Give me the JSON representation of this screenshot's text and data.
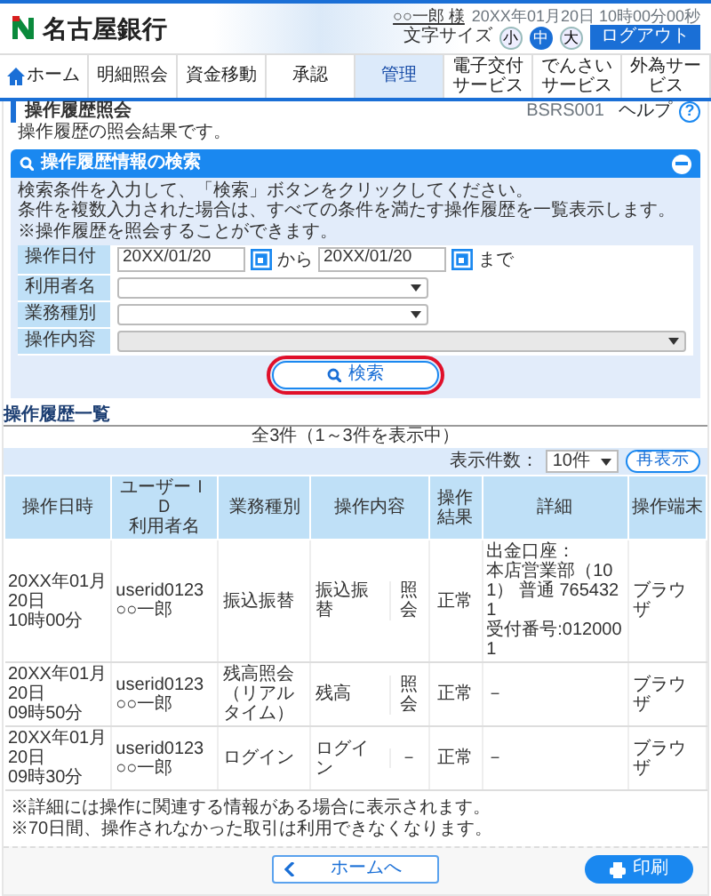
{
  "header": {
    "bank_name": "名古屋銀行",
    "user_name": "○○一郎 様",
    "datetime": "20XX年01月20日 10時00分00秒",
    "font_size_label": "文字サイズ",
    "font_sizes": [
      {
        "label": "小",
        "selected": false
      },
      {
        "label": "中",
        "selected": true
      },
      {
        "label": "大",
        "selected": false
      }
    ],
    "logout": "ログアウト"
  },
  "nav": [
    {
      "label": "ホーム",
      "kind": "home",
      "selected": false
    },
    {
      "label": "明細照会",
      "kind": "plain",
      "selected": false
    },
    {
      "label": "資金移動",
      "kind": "plain",
      "selected": false
    },
    {
      "label": "承認",
      "kind": "plain",
      "selected": false
    },
    {
      "label": "管理",
      "kind": "plain",
      "selected": true
    },
    {
      "label": "電子交付サービス",
      "kind": "plain",
      "selected": false
    },
    {
      "label": "でんさいサービス",
      "kind": "plain",
      "selected": false
    },
    {
      "label": "外為サービス",
      "kind": "plain",
      "selected": false
    }
  ],
  "page": {
    "title": "操作履歴照会",
    "code": "BSRS001",
    "help": "ヘルプ",
    "help_mark": "?"
  },
  "intro": "操作履歴の照会結果です。",
  "search": {
    "title": "操作履歴情報の検索",
    "expanded": true,
    "instructions": [
      "検索条件を入力して、「検索」ボタンをクリックしてください。",
      "条件を複数入力された場合は、すべての条件を満たす操作履歴を一覧表示します。",
      "※操作履歴を照会することができます。"
    ],
    "fields": [
      {
        "label": "操作日付",
        "kind": "date_range",
        "from": "20XX/01/20",
        "between": "から",
        "to": "20XX/01/20",
        "after": "まで"
      },
      {
        "label": "利用者名",
        "kind": "select",
        "disabled": false
      },
      {
        "label": "業務種別",
        "kind": "select",
        "disabled": false
      },
      {
        "label": "操作内容",
        "kind": "select",
        "disabled": true
      }
    ],
    "button": "検索"
  },
  "results": {
    "title": "操作履歴一覧",
    "summary": "全3件（1～3件を表示中）",
    "per_page_label": "表示件数：",
    "per_page": "10件",
    "refresh": "再表示",
    "columns": [
      {
        "lines": [
          "操作日時"
        ]
      },
      {
        "lines": [
          "ユーザーＩＤ",
          "利用者名"
        ]
      },
      {
        "lines": [
          "業務種別"
        ]
      },
      {
        "lines": [
          "操作内容"
        ]
      },
      {
        "lines": [
          "操作結果"
        ]
      },
      {
        "lines": [
          "詳細"
        ]
      },
      {
        "lines": [
          "操作端末"
        ]
      }
    ],
    "rows": [
      {
        "cells": [
          [
            "20XX年01月20日",
            "10時00分"
          ],
          [
            "userid0123",
            "○○一郎"
          ],
          [
            "振込振替"
          ],
          {
            "parts": [
              "振込振替",
              "照会"
            ]
          },
          [
            "正常"
          ],
          [
            "出金口座：",
            "本店営業部（101） 普通 7654321",
            "受付番号:0120001"
          ],
          [
            "ブラウザ"
          ]
        ]
      },
      {
        "cells": [
          [
            "20XX年01月20日",
            "09時50分"
          ],
          [
            "userid0123",
            "○○一郎"
          ],
          [
            "残高照会（リアルタイム）"
          ],
          {
            "parts": [
              "残高",
              "照会"
            ]
          },
          [
            "正常"
          ],
          [
            "－"
          ],
          [
            "ブラウザ"
          ]
        ]
      },
      {
        "cells": [
          [
            "20XX年01月20日",
            "09時30分"
          ],
          [
            "userid0123",
            "○○一郎"
          ],
          [
            "ログイン"
          ],
          {
            "parts": [
              "ログイン",
              "－"
            ]
          },
          [
            "正常"
          ],
          [
            "－"
          ],
          [
            "ブラウザ"
          ]
        ]
      }
    ]
  },
  "notes": [
    "※詳細には操作に関連する情報がある場合に表示されます。",
    "※70日間、操作されなかった取引は利用できなくなります。"
  ],
  "footer": {
    "back": "ホームへ",
    "print": "印刷"
  }
}
